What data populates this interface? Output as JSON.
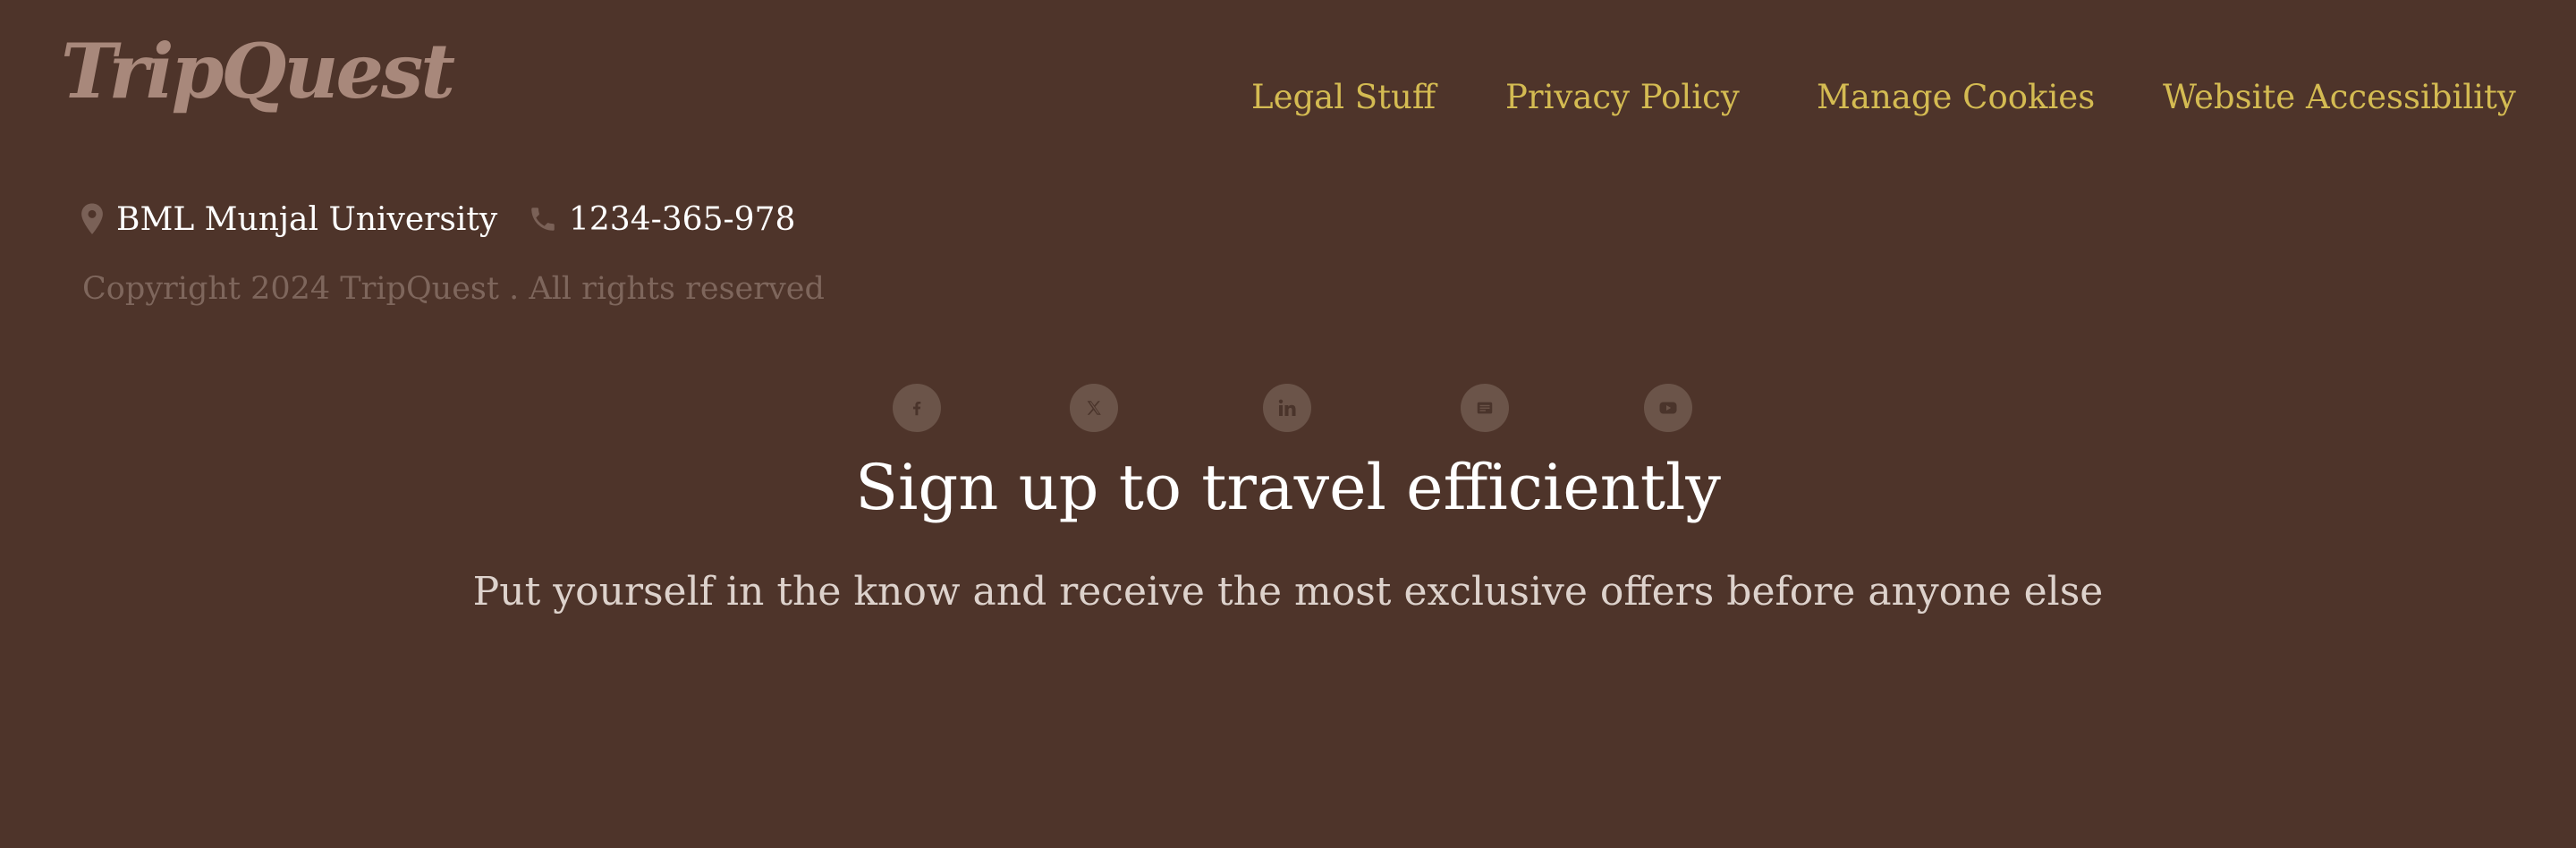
{
  "brand": {
    "logo_text": "TripQuest"
  },
  "nav": {
    "links": [
      {
        "label": "Legal Stuff"
      },
      {
        "label": "Privacy Policy"
      },
      {
        "label": "Manage Cookies"
      },
      {
        "label": "Website Accessibility"
      }
    ]
  },
  "contact": {
    "address": "BML Munjal University",
    "address_icon": "location-pin-icon",
    "phone": "1234-365-978",
    "phone_icon": "phone-icon"
  },
  "copyright": "Copyright 2024 TripQuest . All rights reserved",
  "social": [
    {
      "icon": "facebook-icon"
    },
    {
      "icon": "x-twitter-icon"
    },
    {
      "icon": "linkedin-icon"
    },
    {
      "icon": "email-icon"
    },
    {
      "icon": "youtube-icon"
    }
  ],
  "signup": {
    "title": "Sign up to travel efficiently",
    "subtitle": "Put yourself in the know and receive the most exclusive offers before anyone else"
  },
  "colors": {
    "background": "#4e342a",
    "nav_link": "#d4bb52",
    "logo": "#a8887b",
    "social_circle": "#6b5449",
    "copyright_text": "#7e665c"
  }
}
